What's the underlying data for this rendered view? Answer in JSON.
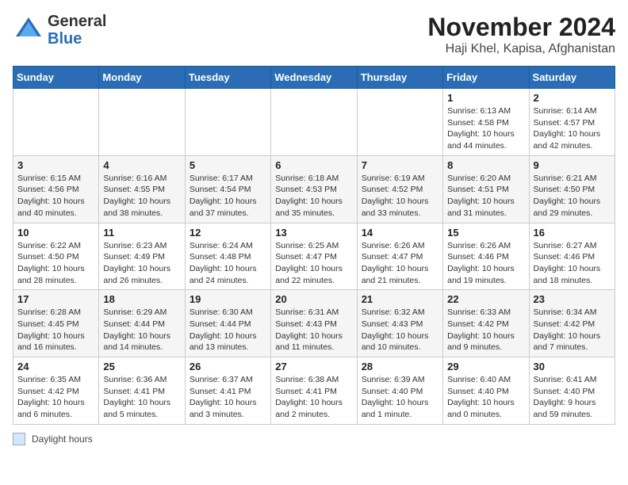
{
  "header": {
    "logo_general": "General",
    "logo_blue": "Blue",
    "title": "November 2024",
    "subtitle": "Haji Khel, Kapisa, Afghanistan"
  },
  "calendar": {
    "days_of_week": [
      "Sunday",
      "Monday",
      "Tuesday",
      "Wednesday",
      "Thursday",
      "Friday",
      "Saturday"
    ],
    "weeks": [
      [
        {
          "day": "",
          "info": ""
        },
        {
          "day": "",
          "info": ""
        },
        {
          "day": "",
          "info": ""
        },
        {
          "day": "",
          "info": ""
        },
        {
          "day": "",
          "info": ""
        },
        {
          "day": "1",
          "info": "Sunrise: 6:13 AM\nSunset: 4:58 PM\nDaylight: 10 hours and 44 minutes."
        },
        {
          "day": "2",
          "info": "Sunrise: 6:14 AM\nSunset: 4:57 PM\nDaylight: 10 hours and 42 minutes."
        }
      ],
      [
        {
          "day": "3",
          "info": "Sunrise: 6:15 AM\nSunset: 4:56 PM\nDaylight: 10 hours and 40 minutes."
        },
        {
          "day": "4",
          "info": "Sunrise: 6:16 AM\nSunset: 4:55 PM\nDaylight: 10 hours and 38 minutes."
        },
        {
          "day": "5",
          "info": "Sunrise: 6:17 AM\nSunset: 4:54 PM\nDaylight: 10 hours and 37 minutes."
        },
        {
          "day": "6",
          "info": "Sunrise: 6:18 AM\nSunset: 4:53 PM\nDaylight: 10 hours and 35 minutes."
        },
        {
          "day": "7",
          "info": "Sunrise: 6:19 AM\nSunset: 4:52 PM\nDaylight: 10 hours and 33 minutes."
        },
        {
          "day": "8",
          "info": "Sunrise: 6:20 AM\nSunset: 4:51 PM\nDaylight: 10 hours and 31 minutes."
        },
        {
          "day": "9",
          "info": "Sunrise: 6:21 AM\nSunset: 4:50 PM\nDaylight: 10 hours and 29 minutes."
        }
      ],
      [
        {
          "day": "10",
          "info": "Sunrise: 6:22 AM\nSunset: 4:50 PM\nDaylight: 10 hours and 28 minutes."
        },
        {
          "day": "11",
          "info": "Sunrise: 6:23 AM\nSunset: 4:49 PM\nDaylight: 10 hours and 26 minutes."
        },
        {
          "day": "12",
          "info": "Sunrise: 6:24 AM\nSunset: 4:48 PM\nDaylight: 10 hours and 24 minutes."
        },
        {
          "day": "13",
          "info": "Sunrise: 6:25 AM\nSunset: 4:47 PM\nDaylight: 10 hours and 22 minutes."
        },
        {
          "day": "14",
          "info": "Sunrise: 6:26 AM\nSunset: 4:47 PM\nDaylight: 10 hours and 21 minutes."
        },
        {
          "day": "15",
          "info": "Sunrise: 6:26 AM\nSunset: 4:46 PM\nDaylight: 10 hours and 19 minutes."
        },
        {
          "day": "16",
          "info": "Sunrise: 6:27 AM\nSunset: 4:46 PM\nDaylight: 10 hours and 18 minutes."
        }
      ],
      [
        {
          "day": "17",
          "info": "Sunrise: 6:28 AM\nSunset: 4:45 PM\nDaylight: 10 hours and 16 minutes."
        },
        {
          "day": "18",
          "info": "Sunrise: 6:29 AM\nSunset: 4:44 PM\nDaylight: 10 hours and 14 minutes."
        },
        {
          "day": "19",
          "info": "Sunrise: 6:30 AM\nSunset: 4:44 PM\nDaylight: 10 hours and 13 minutes."
        },
        {
          "day": "20",
          "info": "Sunrise: 6:31 AM\nSunset: 4:43 PM\nDaylight: 10 hours and 11 minutes."
        },
        {
          "day": "21",
          "info": "Sunrise: 6:32 AM\nSunset: 4:43 PM\nDaylight: 10 hours and 10 minutes."
        },
        {
          "day": "22",
          "info": "Sunrise: 6:33 AM\nSunset: 4:42 PM\nDaylight: 10 hours and 9 minutes."
        },
        {
          "day": "23",
          "info": "Sunrise: 6:34 AM\nSunset: 4:42 PM\nDaylight: 10 hours and 7 minutes."
        }
      ],
      [
        {
          "day": "24",
          "info": "Sunrise: 6:35 AM\nSunset: 4:42 PM\nDaylight: 10 hours and 6 minutes."
        },
        {
          "day": "25",
          "info": "Sunrise: 6:36 AM\nSunset: 4:41 PM\nDaylight: 10 hours and 5 minutes."
        },
        {
          "day": "26",
          "info": "Sunrise: 6:37 AM\nSunset: 4:41 PM\nDaylight: 10 hours and 3 minutes."
        },
        {
          "day": "27",
          "info": "Sunrise: 6:38 AM\nSunset: 4:41 PM\nDaylight: 10 hours and 2 minutes."
        },
        {
          "day": "28",
          "info": "Sunrise: 6:39 AM\nSunset: 4:40 PM\nDaylight: 10 hours and 1 minute."
        },
        {
          "day": "29",
          "info": "Sunrise: 6:40 AM\nSunset: 4:40 PM\nDaylight: 10 hours and 0 minutes."
        },
        {
          "day": "30",
          "info": "Sunrise: 6:41 AM\nSunset: 4:40 PM\nDaylight: 9 hours and 59 minutes."
        }
      ]
    ]
  },
  "footer": {
    "legend_label": "Daylight hours"
  }
}
